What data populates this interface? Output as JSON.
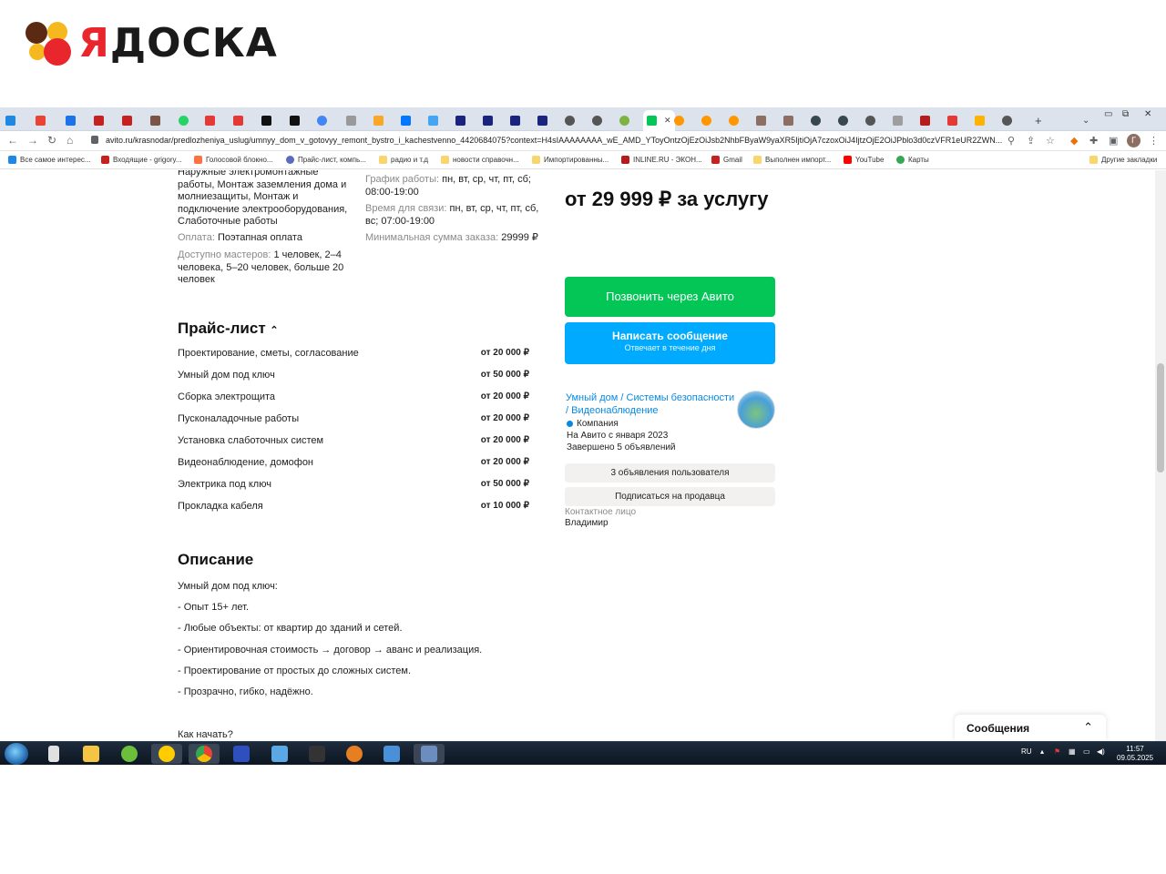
{
  "logo": {
    "text_first": "Я",
    "text_rest": "ДОСКА"
  },
  "browser": {
    "url": "avito.ru/krasnodar/predlozheniya_uslug/umnyy_dom_v_gotovyy_remont_bystro_i_kachestvenno_4420684075?context=H4sIAAAAAAAA_wE_AMD_YToyOntzOjEzOiJsb2NhbFByaW9yaXR5IjtiOjA7czoxOiJ4IjtzOjE2OiJPblo3d0czVFR1eUR2ZWN...",
    "profile_initial": "Г",
    "bookmarks": [
      "Все самое интерес...",
      "Входящие - grigory...",
      "Голосовой блокно...",
      "Прайс-лист, компь...",
      "радио и т.д",
      "новости справочн...",
      "Импортированны...",
      "INLINE.RU - ЭКОН...",
      "Gmail",
      "Выполнен импорт...",
      "YouTube",
      "Карты",
      "Другие закладки"
    ]
  },
  "details": {
    "services_text": "Наружные электромонтажные работы, Монтаж заземления дома и молниезащиты, Монтаж и подключение электрооборудования, Слаботочные работы",
    "payment_label": "Оплата:",
    "payment_value": "Поэтапная оплата",
    "masters_label": "Доступно мастеров:",
    "masters_value": "1 человек, 2–4 человека, 5–20 человек, больше 20 человек",
    "schedule_label": "График работы:",
    "schedule_value": "пн, вт, ср, чт, пт, сб; 08:00-19:00",
    "contact_time_label": "Время для связи:",
    "contact_time_value": "пн, вт, ср, чт, пт, сб, вс; 07:00-19:00",
    "min_order_label": "Минимальная сумма заказа:",
    "min_order_value": "29999 ₽"
  },
  "price_main": "от 29 999 ₽ за услугу",
  "call_button": "Позвонить через Авито",
  "message_button": {
    "title": "Написать сообщение",
    "subtitle": "Отвечает в течение дня"
  },
  "seller": {
    "name": "Умный дом / Системы безопасности / Видеонаблюдение",
    "type": "Компания",
    "since": "На Авито с января 2023",
    "completed": "Завершено 5 объявлений",
    "ads_button": "3 объявления пользователя",
    "subscribe_button": "Подписаться на продавца",
    "contact_label": "Контактное лицо",
    "contact_name": "Владимир"
  },
  "pricelist": {
    "title": "Прайс-лист",
    "items": [
      {
        "name": "Проектирование, сметы, согласование",
        "price": "от 20 000 ₽"
      },
      {
        "name": "Умный дом под ключ",
        "price": "от 50 000 ₽"
      },
      {
        "name": "Сборка электрощита",
        "price": "от 20 000 ₽"
      },
      {
        "name": "Пусконаладочные работы",
        "price": "от 20 000 ₽"
      },
      {
        "name": "Установка слаботочных систем",
        "price": "от 20 000 ₽"
      },
      {
        "name": "Видеонаблюдение, домофон",
        "price": "от 20 000 ₽"
      },
      {
        "name": "Электрика под ключ",
        "price": "от 50 000 ₽"
      },
      {
        "name": "Прокладка кабеля",
        "price": "от 10 000 ₽"
      }
    ]
  },
  "description": {
    "title": "Описание",
    "lines": [
      "Умный дом под ключ:",
      "- Опыт 15+ лет.",
      "- Любые объекты: от квартир до зданий и сетей.",
      "- Ориентировочная стоимость → договор → аванс и реализация.",
      "- Проектирование от простых до сложных систем.",
      "- Прозрачно, гибко, надёжно."
    ],
    "how_to_start": "Как начать?"
  },
  "messages_widget": "Сообщения",
  "taskbar": {
    "lang": "RU",
    "time": "11:57",
    "date": "09.05.2025"
  }
}
